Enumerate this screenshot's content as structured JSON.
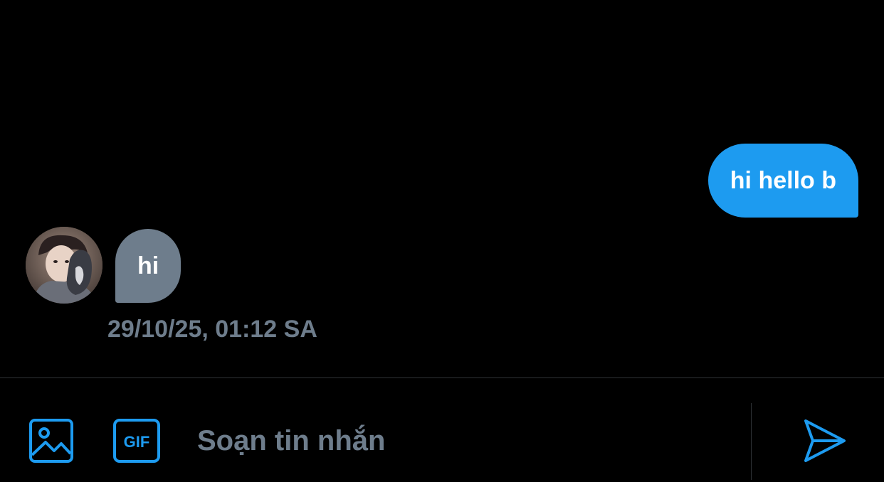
{
  "colors": {
    "background": "#000000",
    "accent": "#1d9bf0",
    "incoming_bubble": "#6e7d8c",
    "muted_text": "#6e7d8c",
    "divider": "#2f3336"
  },
  "conversation": {
    "messages": [
      {
        "direction": "outgoing",
        "text": "hi hello b"
      },
      {
        "direction": "incoming",
        "text": "hi",
        "timestamp": "29/10/25, 01:12 SA"
      }
    ]
  },
  "composer": {
    "placeholder": "Soạn tin nhắn",
    "media_icon": "image-icon",
    "gif_icon": "gif-icon",
    "gif_label": "GIF",
    "send_icon": "send-icon"
  }
}
